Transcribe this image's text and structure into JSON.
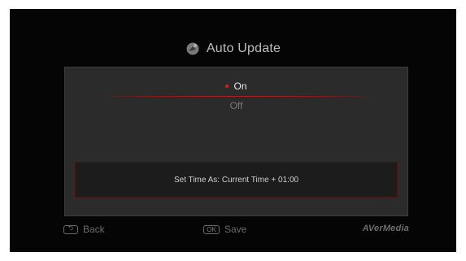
{
  "screen": {
    "title": "Auto Update",
    "title_icon": "satellite-dish-icon"
  },
  "options": {
    "on": "On",
    "off": "Off",
    "selected": "On"
  },
  "info": {
    "text": "Set Time As: Current Time + 01:00"
  },
  "footer": {
    "back_key": "⮌",
    "back_label": "Back",
    "save_key": "OK",
    "save_label": "Save",
    "brand": "AVerMedia"
  },
  "colors": {
    "accent_red": "#d81e1e",
    "background": "#050505",
    "panel": "#2b2b2b"
  }
}
